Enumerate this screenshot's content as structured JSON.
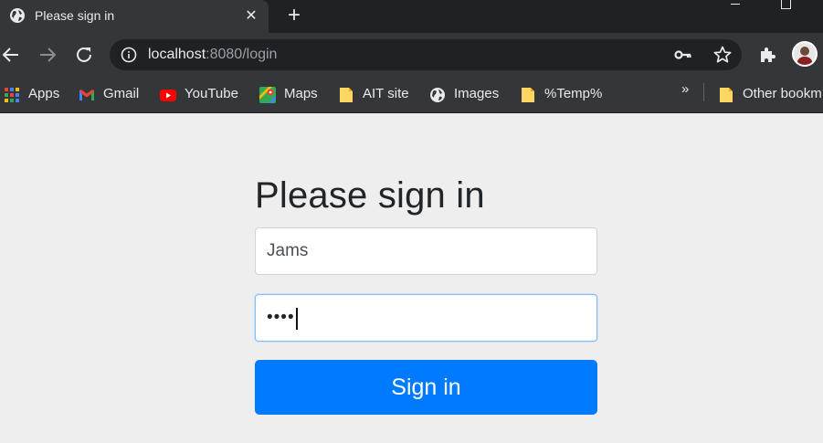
{
  "tab": {
    "title": "Please sign in",
    "close_glyph": "✕",
    "favicon": "globe-icon"
  },
  "new_tab_glyph": "+",
  "address_bar": {
    "host": "localhost",
    "rest": ":8080/login"
  },
  "bookmarks": [
    {
      "label": "Apps",
      "icon": "apps-grid-icon"
    },
    {
      "label": "Gmail",
      "icon": "gmail-icon"
    },
    {
      "label": "YouTube",
      "icon": "youtube-icon"
    },
    {
      "label": "Maps",
      "icon": "maps-icon"
    },
    {
      "label": "AIT site",
      "icon": "bookmark-page-icon"
    },
    {
      "label": "Images",
      "icon": "globe-icon"
    },
    {
      "label": "%Temp%",
      "icon": "bookmark-page-icon"
    }
  ],
  "bookmarks_overflow": "»",
  "other_bookmarks": "Other bookm",
  "login": {
    "heading": "Please sign in",
    "username_value": "Jams",
    "password_mask": "••••",
    "submit_label": "Sign in"
  },
  "colors": {
    "primary": "#007bff",
    "page_bg": "#eeeeee",
    "chrome_dark": "#35363a",
    "chrome_darker": "#202124"
  }
}
